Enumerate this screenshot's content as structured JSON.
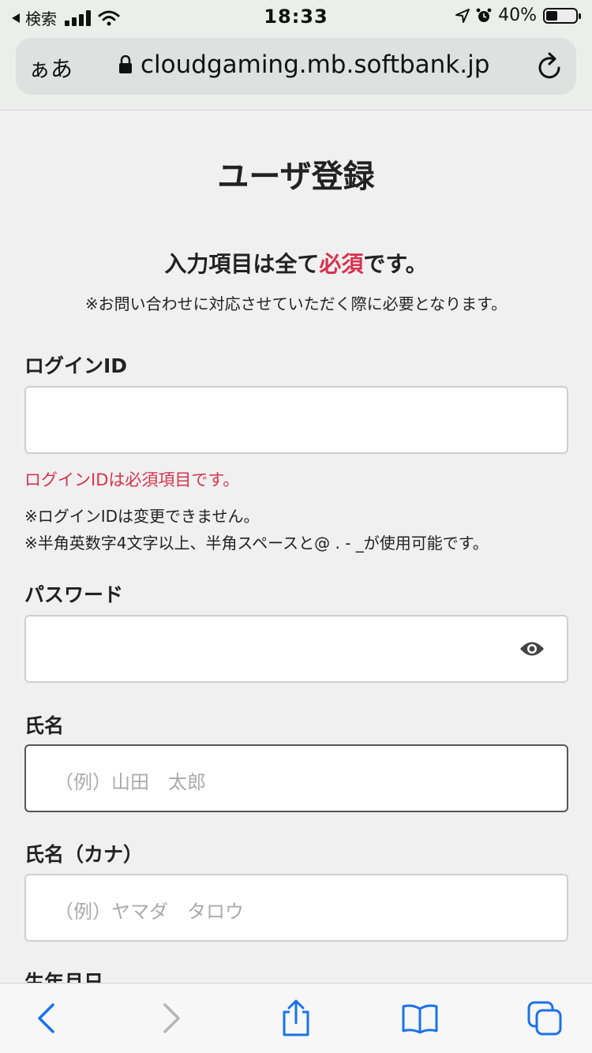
{
  "status": {
    "back_label": "検索",
    "time": "18:33",
    "battery": "40%",
    "battery_level": 0.4
  },
  "browser": {
    "aa_label": "ぁあ",
    "url": "cloudgaming.mb.softbank.jp"
  },
  "page": {
    "title": "ユーザ登録",
    "required_prefix": "入力項目は全て",
    "required_highlight": "必須",
    "required_suffix": "です。",
    "required_sub": "※お問い合わせに対応させていただく際に必要となります。"
  },
  "form": {
    "login_id": {
      "label": "ログインID",
      "value": "",
      "error": "ログインIDは必須項目です。",
      "note1": "※ログインIDは変更できません。",
      "note2": "※半角英数字4文字以上、半角スペースと@ . - _が使用可能です。"
    },
    "password": {
      "label": "パスワード",
      "value": ""
    },
    "name": {
      "label": "氏名",
      "placeholder": "（例）山田　太郎"
    },
    "name_kana": {
      "label": "氏名（カナ）",
      "placeholder": "（例）ヤマダ　タロウ"
    },
    "birthdate": {
      "label": "生年月日"
    }
  },
  "colors": {
    "accent_red": "#d6334e",
    "ios_blue": "#1a73e8"
  }
}
